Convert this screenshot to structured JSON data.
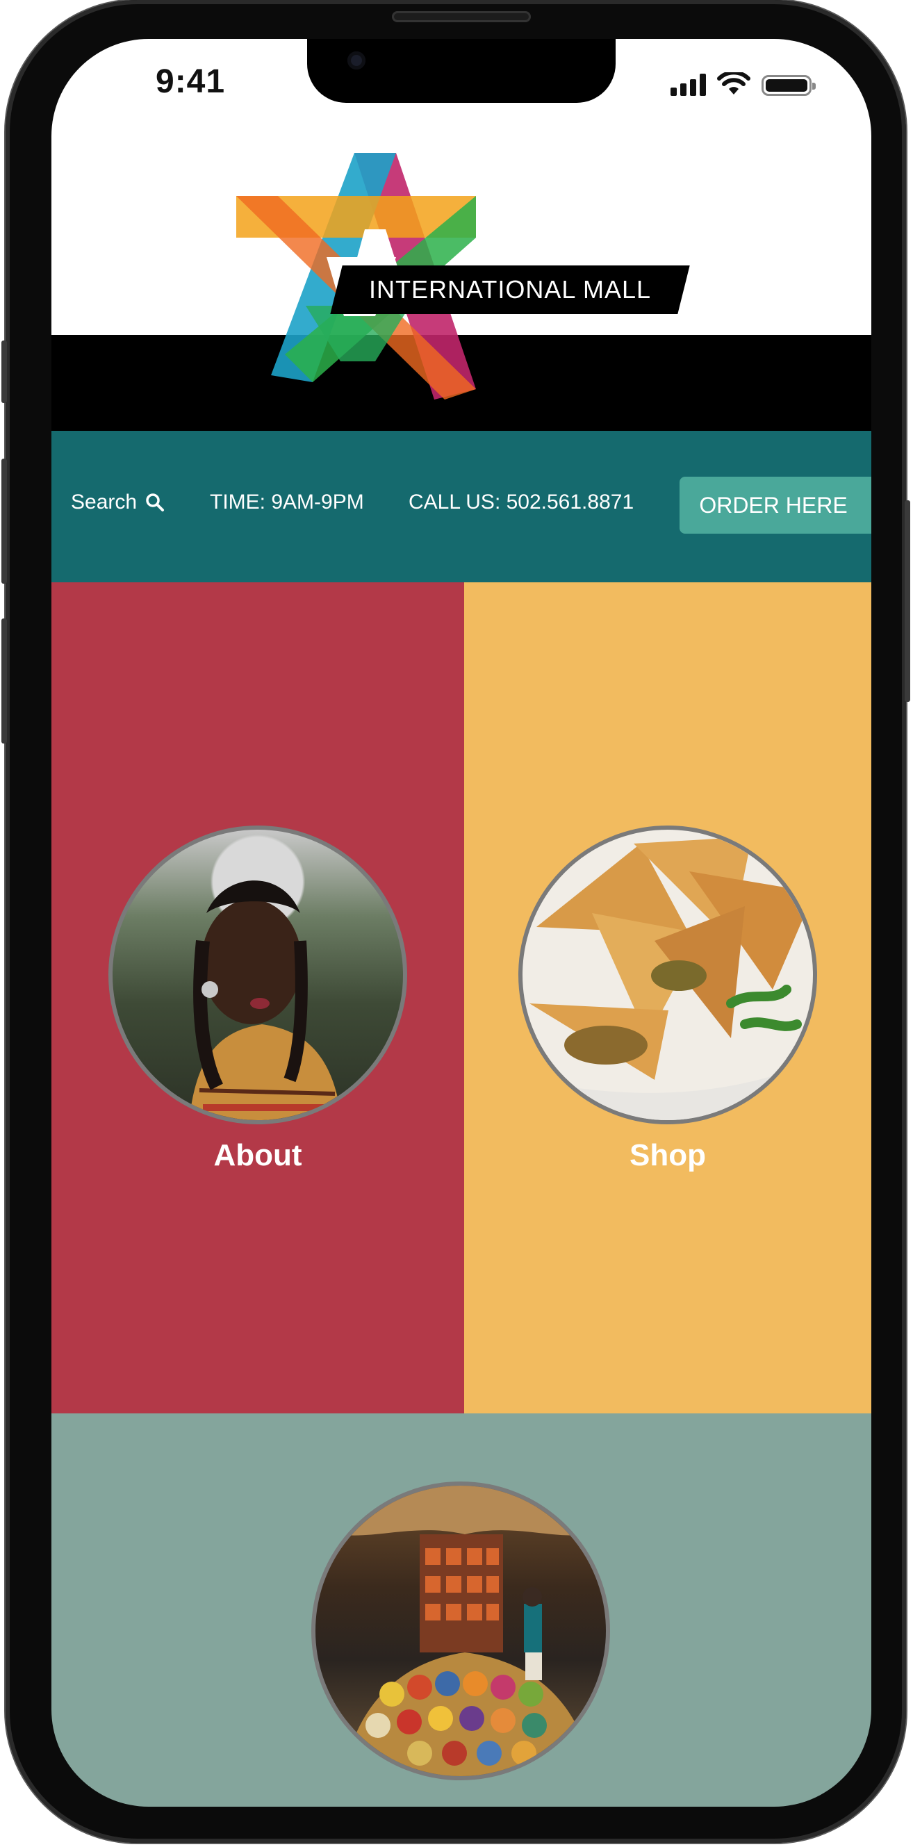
{
  "status_bar": {
    "time": "9:41"
  },
  "header": {
    "logo_text": "INTERNATIONAL MALL"
  },
  "nav": {
    "search_label": "Search",
    "hours": "TIME: 9AM-9PM",
    "phone": "CALL US: 502.561.8871",
    "order_label": "ORDER HERE"
  },
  "tiles": [
    {
      "label": "About",
      "color": "#b33948"
    },
    {
      "label": "Shop",
      "color": "#f2bb5f"
    },
    {
      "label": "",
      "color": "#84a59c"
    }
  ],
  "colors": {
    "nav_bg": "#156a6e",
    "order_button": "#4aa89a"
  }
}
